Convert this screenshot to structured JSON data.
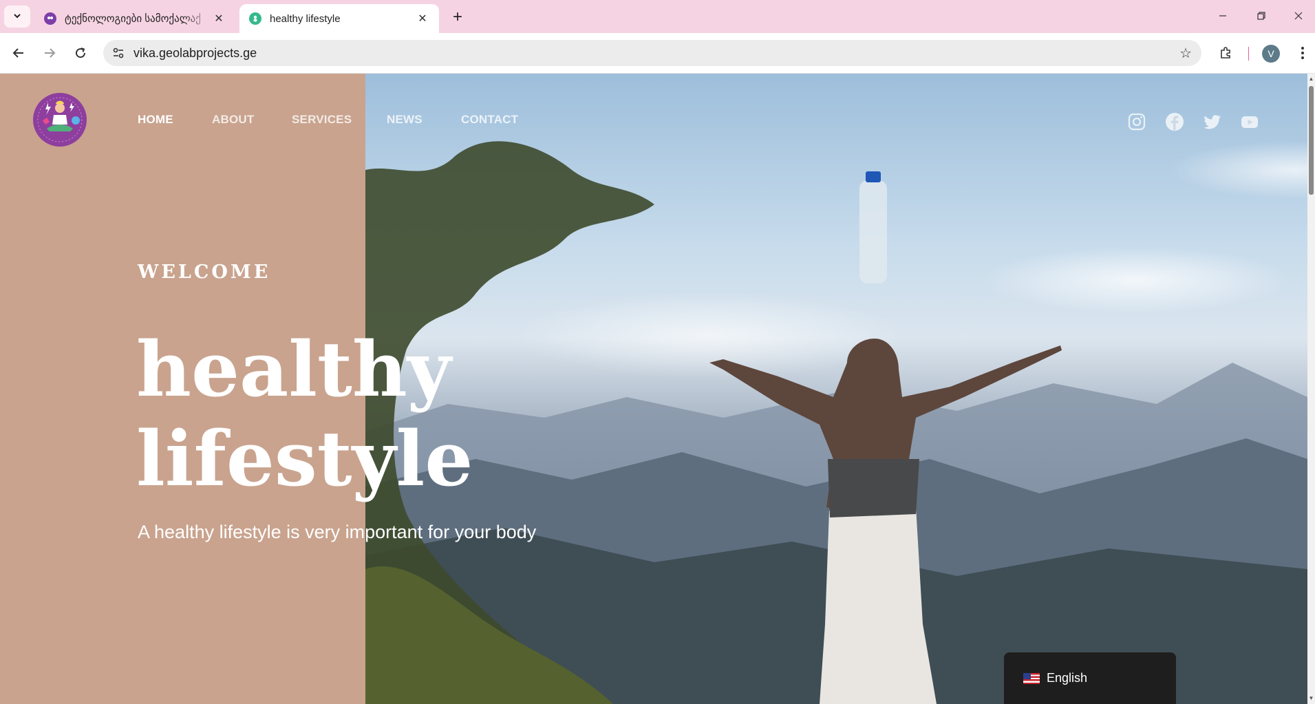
{
  "browser": {
    "tabs": [
      {
        "title": "ტექნოლოგიები სამოქალაქ",
        "active": false
      },
      {
        "title": "healthy lifestyle",
        "active": true
      }
    ],
    "url": "vika.geolabprojects.ge",
    "profile_initial": "V"
  },
  "site": {
    "nav": {
      "home": "HOME",
      "about": "ABOUT",
      "services": "SERVICES",
      "news": "NEWS",
      "contact": "CONTACT"
    },
    "social_icons": [
      "instagram-icon",
      "facebook-icon",
      "twitter-icon",
      "youtube-icon"
    ],
    "hero": {
      "welcome": "WELCOME",
      "title_line1": "healthy",
      "title_line2": "lifestyle",
      "subtitle": "A healthy lifestyle is very important for your body"
    },
    "language_switcher": {
      "label": "English"
    },
    "colors": {
      "panel": "#c9a38e",
      "text": "#ffffff",
      "lang_bg": "#1e1e1e",
      "tabbar": "#f6d3e3"
    }
  }
}
